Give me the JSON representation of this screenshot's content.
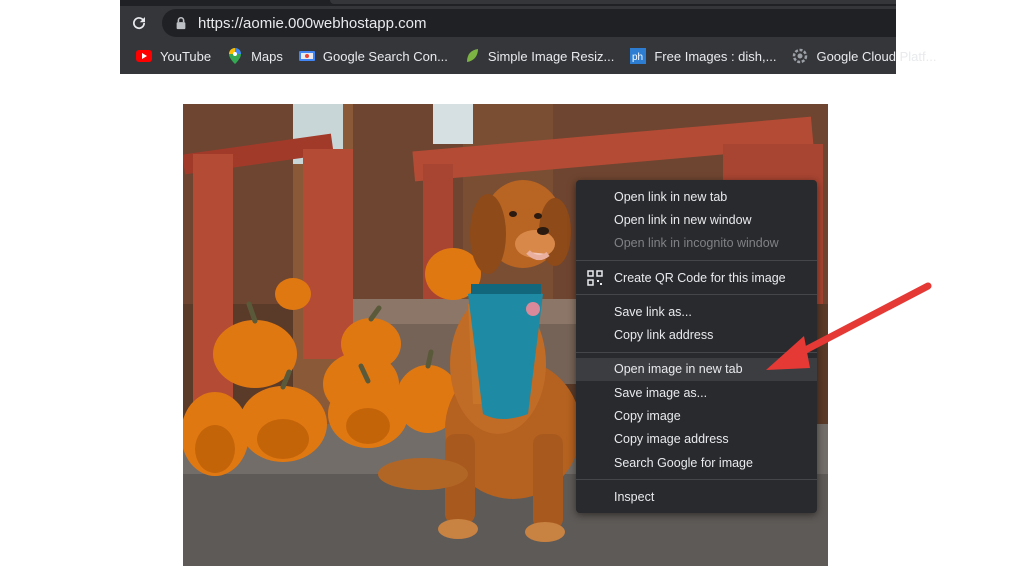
{
  "browser": {
    "url": "https://aomie.000webhostapp.com",
    "bookmarks": [
      {
        "label": "YouTube",
        "icon": "youtube-icon"
      },
      {
        "label": "Maps",
        "icon": "maps-pin-icon"
      },
      {
        "label": "Google Search Con...",
        "icon": "search-console-icon"
      },
      {
        "label": "Simple Image Resiz...",
        "icon": "leaf-icon"
      },
      {
        "label": "Free Images : dish,...",
        "icon": "ph-icon"
      },
      {
        "label": "Google Cloud Platf...",
        "icon": "gear-icon"
      }
    ]
  },
  "context_menu": {
    "items": [
      {
        "label": "Open link in new tab",
        "state": "enabled"
      },
      {
        "label": "Open link in new window",
        "state": "enabled"
      },
      {
        "label": "Open link in incognito window",
        "state": "disabled"
      },
      {
        "label": "Create QR Code for this image",
        "state": "enabled",
        "icon": "qr-code-icon"
      },
      {
        "label": "Save link as...",
        "state": "enabled"
      },
      {
        "label": "Copy link address",
        "state": "enabled"
      },
      {
        "label": "Open image in new tab",
        "state": "highlighted"
      },
      {
        "label": "Save image as...",
        "state": "enabled"
      },
      {
        "label": "Copy image",
        "state": "enabled"
      },
      {
        "label": "Copy image address",
        "state": "enabled"
      },
      {
        "label": "Search Google for image",
        "state": "enabled"
      },
      {
        "label": "Inspect",
        "state": "enabled"
      }
    ]
  },
  "colors": {
    "toolbar": "#35363a",
    "omnibox": "#202124",
    "menu_bg": "#292a2d",
    "menu_highlight": "#3c3d41",
    "arrow": "#e53935"
  }
}
